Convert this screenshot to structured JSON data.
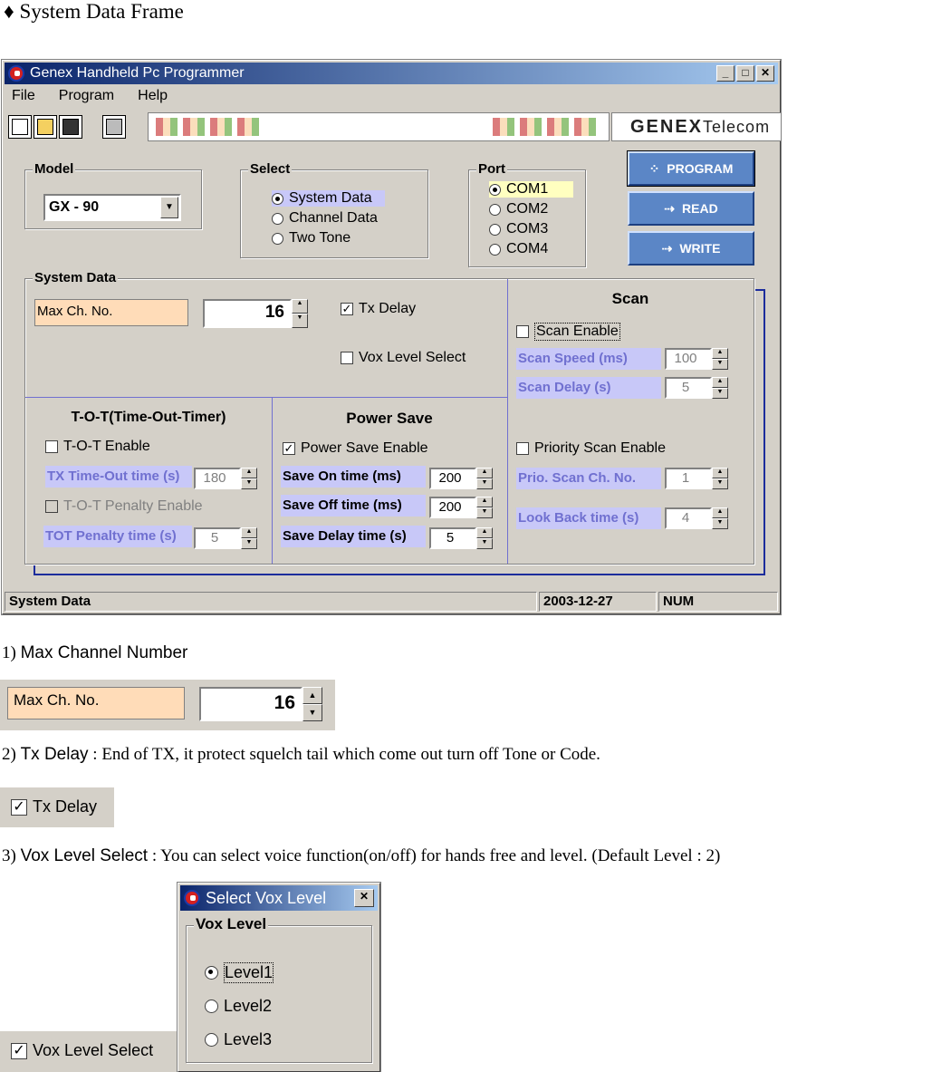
{
  "doc": {
    "heading": "♦ System Data Frame",
    "item1_num": "1)",
    "item1_term": "Max Channel Number",
    "item2_num": "2)",
    "item2_term": "Tx Delay",
    "item2_desc": " : End of TX, it protect squelch tail which come out turn off Tone or Code.",
    "item3_num": "3)",
    "item3_term": "Vox Level Select",
    "item3_desc": " : You can select voice function(on/off) for hands free and level.   (Default Level : 2)"
  },
  "window": {
    "title": "Genex Handheld Pc Programmer",
    "minimize": "_",
    "maximize": "□",
    "close": "✕",
    "menu": [
      "File",
      "Program",
      "Help"
    ],
    "brand_mark": "GENEX",
    "brand_text": "Telecom",
    "model": {
      "title": "Model",
      "value": "GX - 90"
    },
    "select": {
      "title": "Select",
      "options": [
        "System Data",
        "Channel Data",
        "Two Tone"
      ],
      "selected": 0
    },
    "port": {
      "title": "Port",
      "options": [
        "COM1",
        "COM2",
        "COM3",
        "COM4"
      ],
      "selected": 0
    },
    "buttons": {
      "program": "PROGRAM",
      "read": "READ",
      "write": "WRITE"
    },
    "system_data": {
      "title": "System Data",
      "max_ch_label": "Max Ch. No.",
      "max_ch_value": "16",
      "tx_delay": "Tx Delay",
      "tx_delay_checked": true,
      "vox_level_select": "Vox Level Select",
      "vox_checked": false
    },
    "scan": {
      "title": "Scan",
      "scan_enable": "Scan Enable",
      "scan_speed_label": "Scan Speed (ms)",
      "scan_speed_value": "100",
      "scan_delay_label": "Scan Delay (s)",
      "scan_delay_value": "5",
      "priority_scan_enable": "Priority Scan Enable",
      "prio_ch_label": "Prio. Scan Ch. No.",
      "prio_ch_value": "1",
      "look_back_label": "Look Back time (s)",
      "look_back_value": "4"
    },
    "tot": {
      "title": "T-O-T(Time-Out-Timer)",
      "enable": "T-O-T Enable",
      "tx_timeout_label": "TX Time-Out time (s)",
      "tx_timeout_value": "180",
      "penalty_enable": "T-O-T Penalty Enable",
      "penalty_label": "TOT Penalty time (s)",
      "penalty_value": "5"
    },
    "power_save": {
      "title": "Power Save",
      "enable": "Power Save Enable",
      "enable_checked": true,
      "on_label": "Save On time (ms)",
      "on_value": "200",
      "off_label": "Save Off time (ms)",
      "off_value": "200",
      "delay_label": "Save Delay time (s)",
      "delay_value": "5"
    },
    "status": {
      "left": "System Data",
      "date": "2003-12-27",
      "mode": "NUM"
    }
  },
  "snippets": {
    "max_label": "Max Ch. No.",
    "max_value": "16",
    "tx_delay": "Tx Delay",
    "vox_level_select": "Vox Level Select"
  },
  "vox_dialog": {
    "title": "Select Vox Level",
    "close": "✕",
    "group_title": "Vox Level",
    "levels": [
      "Level1",
      "Level2",
      "Level3"
    ],
    "selected": 0
  },
  "colors": {
    "titlebar_start": "#0a246a",
    "titlebar_end": "#a6caf0",
    "button_blue": "#5b86c6",
    "label_lavender": "#c8c8f8",
    "label_peach": "#ffdcb8",
    "highlight_yellow": "#ffffc0",
    "window_gray": "#d4d0c8"
  }
}
